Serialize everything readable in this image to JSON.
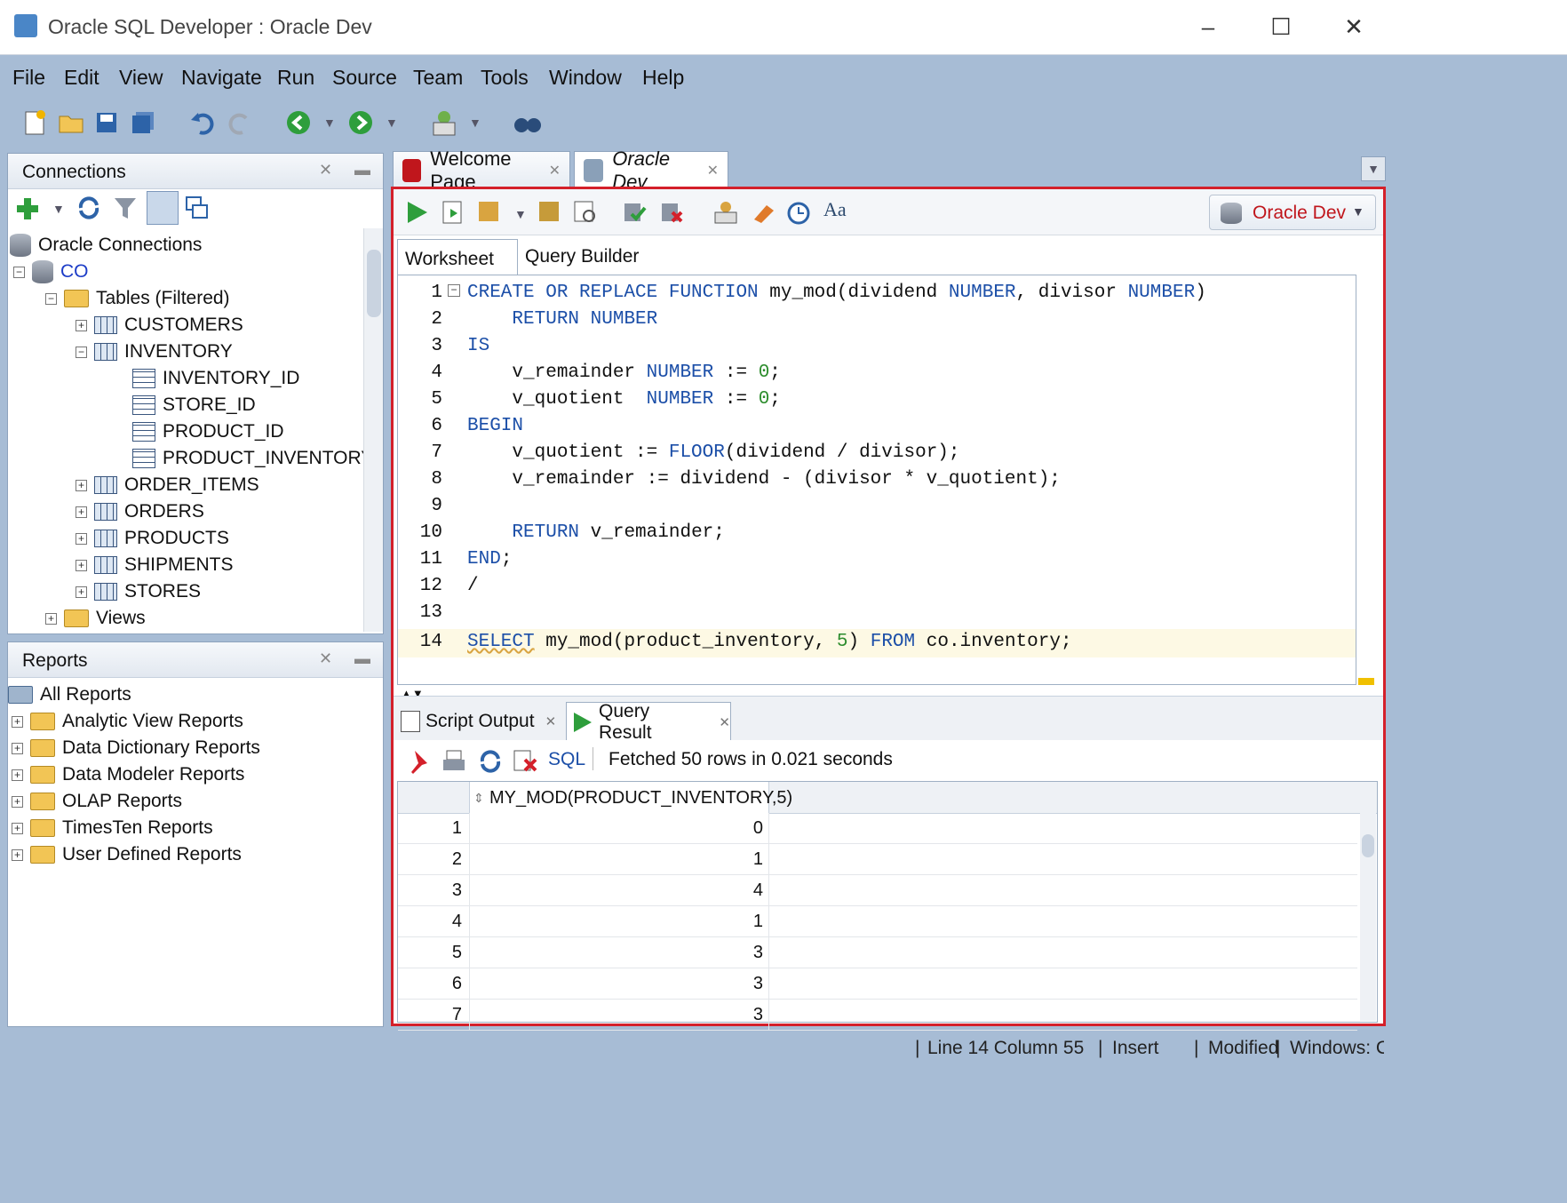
{
  "window": {
    "title": "Oracle SQL Developer : Oracle Dev"
  },
  "menu": [
    "File",
    "Edit",
    "View",
    "Navigate",
    "Run",
    "Source",
    "Team",
    "Tools",
    "Window",
    "Help"
  ],
  "connections": {
    "title": "Connections",
    "tree": [
      {
        "label": "Oracle Connections"
      },
      {
        "label": "CO"
      },
      {
        "label": "Tables (Filtered)"
      },
      {
        "label": "CUSTOMERS"
      },
      {
        "label": "INVENTORY"
      },
      {
        "label": "INVENTORY_ID"
      },
      {
        "label": "STORE_ID"
      },
      {
        "label": "PRODUCT_ID"
      },
      {
        "label": "PRODUCT_INVENTORY"
      },
      {
        "label": "ORDER_ITEMS"
      },
      {
        "label": "ORDERS"
      },
      {
        "label": "PRODUCTS"
      },
      {
        "label": "SHIPMENTS"
      },
      {
        "label": "STORES"
      },
      {
        "label": "Views"
      }
    ]
  },
  "reports": {
    "title": "Reports",
    "items": [
      "All Reports",
      "Analytic View Reports",
      "Data Dictionary Reports",
      "Data Modeler Reports",
      "OLAP Reports",
      "TimesTen Reports",
      "User Defined Reports"
    ]
  },
  "tabs": {
    "welcome": "Welcome Page",
    "oracle_dev": "Oracle Dev"
  },
  "worksheet": {
    "connection": "Oracle Dev",
    "subtabs": [
      "Worksheet",
      "Query Builder"
    ],
    "line_numbers": [
      "1",
      "2",
      "3",
      "4",
      "5",
      "6",
      "7",
      "8",
      "9",
      "10",
      "11",
      "12",
      "13",
      "14"
    ]
  },
  "output": {
    "tabs": [
      "Script Output",
      "Query Result"
    ],
    "sql_label": "SQL",
    "fetch_status": "Fetched 50 rows in 0.021 seconds",
    "column": "MY_MOD(PRODUCT_INVENTORY,5)",
    "rows": [
      {
        "n": "1",
        "v": "0"
      },
      {
        "n": "2",
        "v": "1"
      },
      {
        "n": "3",
        "v": "4"
      },
      {
        "n": "4",
        "v": "1"
      },
      {
        "n": "5",
        "v": "3"
      },
      {
        "n": "6",
        "v": "3"
      },
      {
        "n": "7",
        "v": "3"
      }
    ]
  },
  "status": {
    "position": "Line 14 Column 55",
    "mode": "Insert",
    "modified": "Modified",
    "encoding": "Windows: CF"
  },
  "colors": {
    "keyword": "#1c4fa8",
    "number": "#2c8c2c",
    "highlight_frame": "#d4202a",
    "connection_label": "#c0161c"
  }
}
